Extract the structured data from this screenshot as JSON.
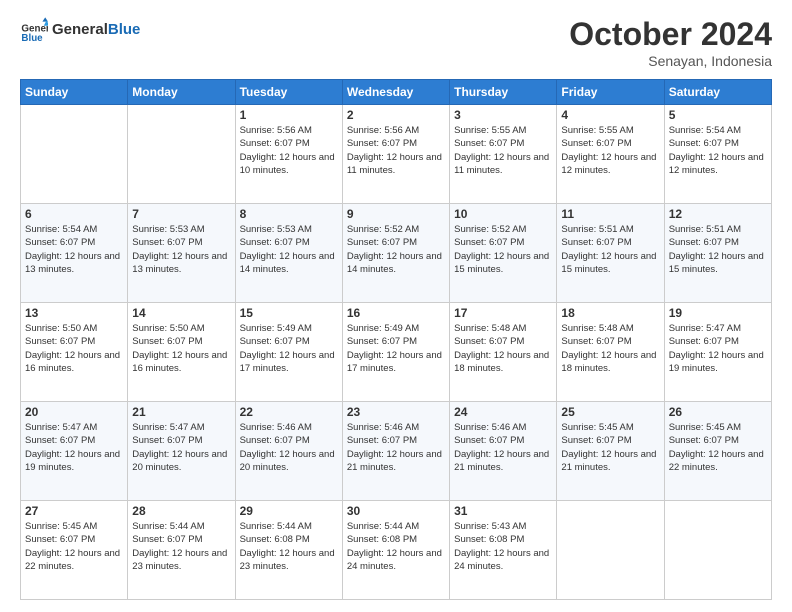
{
  "header": {
    "logo_text_general": "General",
    "logo_text_blue": "Blue",
    "month_title": "October 2024",
    "subtitle": "Senayan, Indonesia"
  },
  "days_of_week": [
    "Sunday",
    "Monday",
    "Tuesday",
    "Wednesday",
    "Thursday",
    "Friday",
    "Saturday"
  ],
  "weeks": [
    [
      {
        "day": "",
        "info": ""
      },
      {
        "day": "",
        "info": ""
      },
      {
        "day": "1",
        "info": "Sunrise: 5:56 AM\nSunset: 6:07 PM\nDaylight: 12 hours and 10 minutes."
      },
      {
        "day": "2",
        "info": "Sunrise: 5:56 AM\nSunset: 6:07 PM\nDaylight: 12 hours and 11 minutes."
      },
      {
        "day": "3",
        "info": "Sunrise: 5:55 AM\nSunset: 6:07 PM\nDaylight: 12 hours and 11 minutes."
      },
      {
        "day": "4",
        "info": "Sunrise: 5:55 AM\nSunset: 6:07 PM\nDaylight: 12 hours and 12 minutes."
      },
      {
        "day": "5",
        "info": "Sunrise: 5:54 AM\nSunset: 6:07 PM\nDaylight: 12 hours and 12 minutes."
      }
    ],
    [
      {
        "day": "6",
        "info": "Sunrise: 5:54 AM\nSunset: 6:07 PM\nDaylight: 12 hours and 13 minutes."
      },
      {
        "day": "7",
        "info": "Sunrise: 5:53 AM\nSunset: 6:07 PM\nDaylight: 12 hours and 13 minutes."
      },
      {
        "day": "8",
        "info": "Sunrise: 5:53 AM\nSunset: 6:07 PM\nDaylight: 12 hours and 14 minutes."
      },
      {
        "day": "9",
        "info": "Sunrise: 5:52 AM\nSunset: 6:07 PM\nDaylight: 12 hours and 14 minutes."
      },
      {
        "day": "10",
        "info": "Sunrise: 5:52 AM\nSunset: 6:07 PM\nDaylight: 12 hours and 15 minutes."
      },
      {
        "day": "11",
        "info": "Sunrise: 5:51 AM\nSunset: 6:07 PM\nDaylight: 12 hours and 15 minutes."
      },
      {
        "day": "12",
        "info": "Sunrise: 5:51 AM\nSunset: 6:07 PM\nDaylight: 12 hours and 15 minutes."
      }
    ],
    [
      {
        "day": "13",
        "info": "Sunrise: 5:50 AM\nSunset: 6:07 PM\nDaylight: 12 hours and 16 minutes."
      },
      {
        "day": "14",
        "info": "Sunrise: 5:50 AM\nSunset: 6:07 PM\nDaylight: 12 hours and 16 minutes."
      },
      {
        "day": "15",
        "info": "Sunrise: 5:49 AM\nSunset: 6:07 PM\nDaylight: 12 hours and 17 minutes."
      },
      {
        "day": "16",
        "info": "Sunrise: 5:49 AM\nSunset: 6:07 PM\nDaylight: 12 hours and 17 minutes."
      },
      {
        "day": "17",
        "info": "Sunrise: 5:48 AM\nSunset: 6:07 PM\nDaylight: 12 hours and 18 minutes."
      },
      {
        "day": "18",
        "info": "Sunrise: 5:48 AM\nSunset: 6:07 PM\nDaylight: 12 hours and 18 minutes."
      },
      {
        "day": "19",
        "info": "Sunrise: 5:47 AM\nSunset: 6:07 PM\nDaylight: 12 hours and 19 minutes."
      }
    ],
    [
      {
        "day": "20",
        "info": "Sunrise: 5:47 AM\nSunset: 6:07 PM\nDaylight: 12 hours and 19 minutes."
      },
      {
        "day": "21",
        "info": "Sunrise: 5:47 AM\nSunset: 6:07 PM\nDaylight: 12 hours and 20 minutes."
      },
      {
        "day": "22",
        "info": "Sunrise: 5:46 AM\nSunset: 6:07 PM\nDaylight: 12 hours and 20 minutes."
      },
      {
        "day": "23",
        "info": "Sunrise: 5:46 AM\nSunset: 6:07 PM\nDaylight: 12 hours and 21 minutes."
      },
      {
        "day": "24",
        "info": "Sunrise: 5:46 AM\nSunset: 6:07 PM\nDaylight: 12 hours and 21 minutes."
      },
      {
        "day": "25",
        "info": "Sunrise: 5:45 AM\nSunset: 6:07 PM\nDaylight: 12 hours and 21 minutes."
      },
      {
        "day": "26",
        "info": "Sunrise: 5:45 AM\nSunset: 6:07 PM\nDaylight: 12 hours and 22 minutes."
      }
    ],
    [
      {
        "day": "27",
        "info": "Sunrise: 5:45 AM\nSunset: 6:07 PM\nDaylight: 12 hours and 22 minutes."
      },
      {
        "day": "28",
        "info": "Sunrise: 5:44 AM\nSunset: 6:07 PM\nDaylight: 12 hours and 23 minutes."
      },
      {
        "day": "29",
        "info": "Sunrise: 5:44 AM\nSunset: 6:08 PM\nDaylight: 12 hours and 23 minutes."
      },
      {
        "day": "30",
        "info": "Sunrise: 5:44 AM\nSunset: 6:08 PM\nDaylight: 12 hours and 24 minutes."
      },
      {
        "day": "31",
        "info": "Sunrise: 5:43 AM\nSunset: 6:08 PM\nDaylight: 12 hours and 24 minutes."
      },
      {
        "day": "",
        "info": ""
      },
      {
        "day": "",
        "info": ""
      }
    ]
  ]
}
